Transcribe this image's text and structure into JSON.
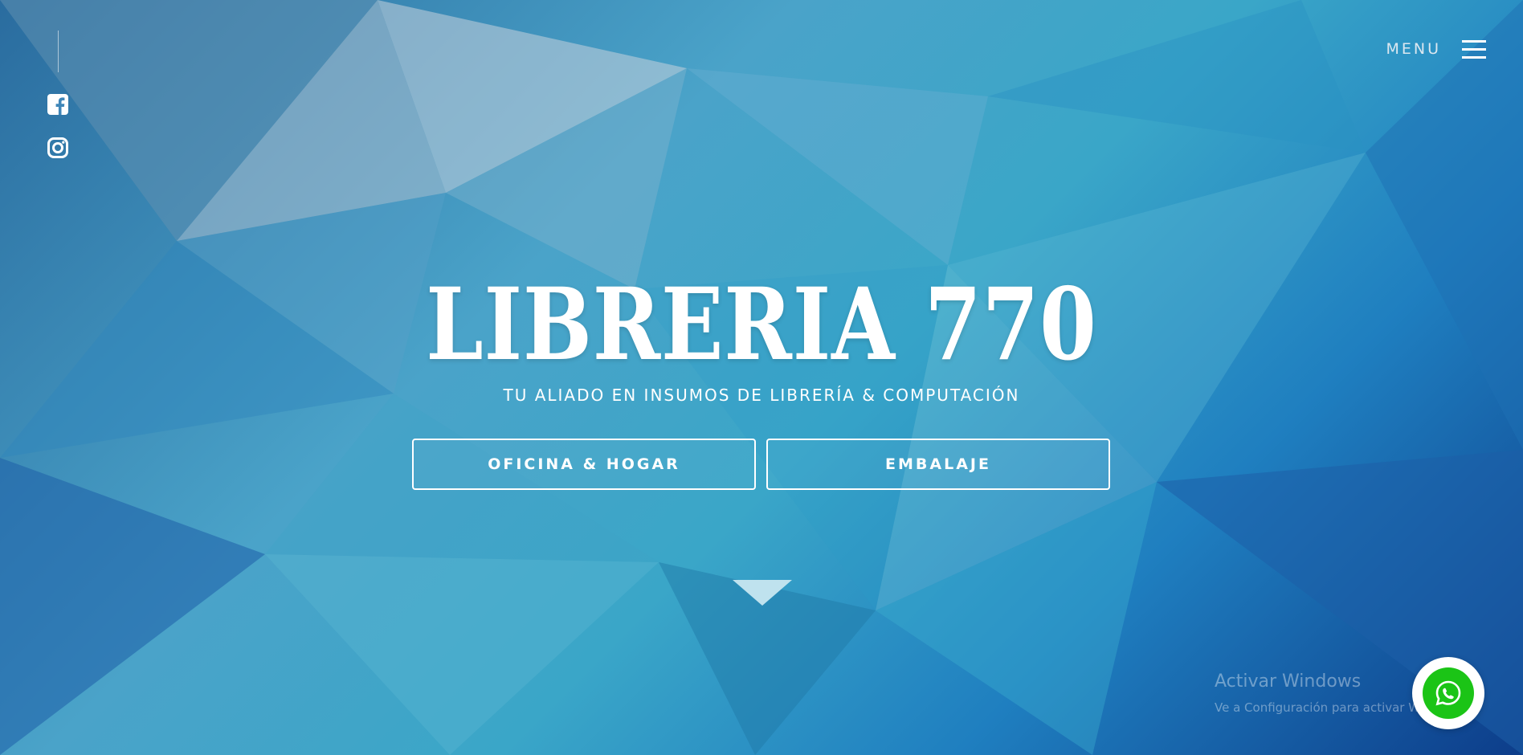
{
  "social": {
    "facebook_icon": "facebook-icon",
    "instagram_icon": "instagram-icon"
  },
  "menu": {
    "label": "MENU",
    "icon": "hamburger-icon"
  },
  "hero": {
    "title": "LIBRERIA 770",
    "subtitle": "TU ALIADO EN INSUMOS DE LIBRERÍA & COMPUTACIÓN",
    "buttons": [
      {
        "label": "OFICINA & HOGAR"
      },
      {
        "label": "EMBALAJE"
      }
    ],
    "scroll_icon": "triangle-down-icon"
  },
  "watermark": {
    "title": "Activar Windows",
    "subtitle": "Ve a Configuración para activar Windows."
  },
  "whatsapp": {
    "icon": "whatsapp-icon"
  },
  "colors": {
    "background_light": "#4aa3c9",
    "background_dark": "#0d3d8a",
    "text": "#ffffff",
    "whatsapp_green": "#1bc416"
  }
}
